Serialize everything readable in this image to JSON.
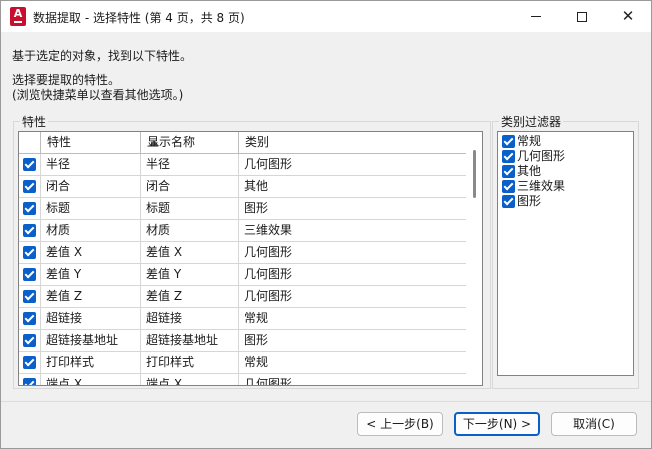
{
  "window": {
    "title": "数据提取 - 选择特性 (第 4 页，共 8 页)",
    "app_icon_letter": "A"
  },
  "intro": {
    "line1": "基于选定的对象，找到以下特性。",
    "line2": "选择要提取的特性。",
    "line3": "(浏览快捷菜单以查看其他选项。)"
  },
  "properties": {
    "group_label": "特性",
    "columns": [
      "特性",
      "显示名称",
      "类别"
    ],
    "sort_column": "特性",
    "rows": [
      {
        "checked": true,
        "property": "半径",
        "display": "半径",
        "category": "几何图形"
      },
      {
        "checked": true,
        "property": "闭合",
        "display": "闭合",
        "category": "其他"
      },
      {
        "checked": true,
        "property": "标题",
        "display": "标题",
        "category": "图形"
      },
      {
        "checked": true,
        "property": "材质",
        "display": "材质",
        "category": "三维效果"
      },
      {
        "checked": true,
        "property": "差值 X",
        "display": "差值 X",
        "category": "几何图形"
      },
      {
        "checked": true,
        "property": "差值 Y",
        "display": "差值 Y",
        "category": "几何图形"
      },
      {
        "checked": true,
        "property": "差值 Z",
        "display": "差值 Z",
        "category": "几何图形"
      },
      {
        "checked": true,
        "property": "超链接",
        "display": "超链接",
        "category": "常规"
      },
      {
        "checked": true,
        "property": "超链接基地址",
        "display": "超链接基地址",
        "category": "图形"
      },
      {
        "checked": true,
        "property": "打印样式",
        "display": "打印样式",
        "category": "常规"
      },
      {
        "checked": true,
        "property": "端点 X",
        "display": "端点 X",
        "category": "几何图形"
      }
    ]
  },
  "category_filter": {
    "group_label": "类别过滤器",
    "items": [
      {
        "checked": true,
        "label": "常规"
      },
      {
        "checked": true,
        "label": "几何图形"
      },
      {
        "checked": true,
        "label": "其他"
      },
      {
        "checked": true,
        "label": "三维效果"
      },
      {
        "checked": true,
        "label": "图形"
      }
    ]
  },
  "buttons": {
    "back": "< 上一步(B)",
    "next": "下一步(N) >",
    "cancel": "取消(C)"
  },
  "colors": {
    "accent": "#0a5fc8",
    "app_red": "#c8102e"
  }
}
